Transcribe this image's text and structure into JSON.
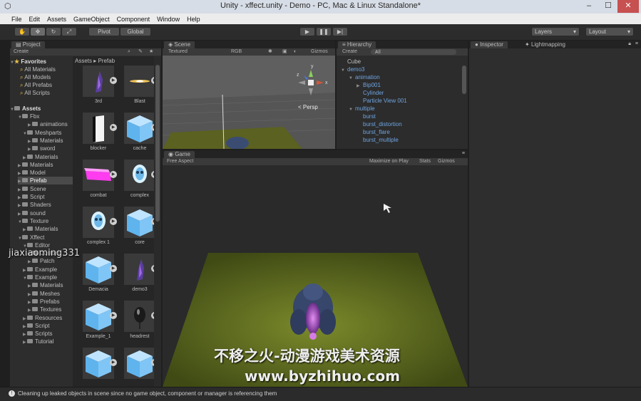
{
  "window": {
    "title": "Unity - xffect.unity - Demo - PC, Mac & Linux Standalone*",
    "minimize": "–",
    "maximize": "☐",
    "close": "✕"
  },
  "menu": [
    "File",
    "Edit",
    "Assets",
    "GameObject",
    "Component",
    "Window",
    "Help"
  ],
  "toolbar": {
    "pivot": "Pivot",
    "global": "Global",
    "layers": "Layers",
    "layout": "Layout"
  },
  "project": {
    "tab": "Project",
    "create": "Create",
    "breadcrumb": "Assets ▸ Prefab",
    "favorites_label": "Favorites",
    "favorites": [
      "All Materials",
      "All Models",
      "All Prefabs",
      "All Scripts"
    ],
    "assets_label": "Assets",
    "tree": [
      {
        "label": "Fbx",
        "indent": 1,
        "open": true
      },
      {
        "label": "animations",
        "indent": 3,
        "open": false
      },
      {
        "label": "Meshparts",
        "indent": 2,
        "open": true
      },
      {
        "label": "Materials",
        "indent": 3,
        "open": false
      },
      {
        "label": "sword",
        "indent": 3,
        "open": false
      },
      {
        "label": "Materials",
        "indent": 2,
        "open": false
      },
      {
        "label": "Materials",
        "indent": 1,
        "open": false
      },
      {
        "label": "Model",
        "indent": 1,
        "open": false
      },
      {
        "label": "Prefab",
        "indent": 1,
        "open": false,
        "selected": true
      },
      {
        "label": "Scene",
        "indent": 1,
        "open": false
      },
      {
        "label": "Script",
        "indent": 1,
        "open": false
      },
      {
        "label": "Shaders",
        "indent": 1,
        "open": false
      },
      {
        "label": "sound",
        "indent": 1,
        "open": false
      },
      {
        "label": "Texture",
        "indent": 1,
        "open": true
      },
      {
        "label": "Materials",
        "indent": 2,
        "open": false
      },
      {
        "label": "Xffect",
        "indent": 1,
        "open": true
      },
      {
        "label": "Editor",
        "indent": 2,
        "open": true
      },
      {
        "label": "Custom",
        "indent": 3,
        "open": false
      },
      {
        "label": "Patch",
        "indent": 3,
        "open": false
      },
      {
        "label": "Example",
        "indent": 2,
        "open": false
      },
      {
        "label": "Example",
        "indent": 2,
        "open": true
      },
      {
        "label": "Materials",
        "indent": 3,
        "open": false
      },
      {
        "label": "Meshes",
        "indent": 3,
        "open": false
      },
      {
        "label": "Prefabs",
        "indent": 3,
        "open": false
      },
      {
        "label": "Textures",
        "indent": 3,
        "open": false
      },
      {
        "label": "Resources",
        "indent": 2,
        "open": false
      },
      {
        "label": "Script",
        "indent": 2,
        "open": false
      },
      {
        "label": "Scripts",
        "indent": 2,
        "open": false
      },
      {
        "label": "Tutorial",
        "indent": 2,
        "open": false
      }
    ],
    "assets": [
      {
        "label": "3rd",
        "kind": "figure"
      },
      {
        "label": "Blast",
        "kind": "streak"
      },
      {
        "label": "blocker",
        "kind": "slab"
      },
      {
        "label": "cache",
        "kind": "cube"
      },
      {
        "label": "combat",
        "kind": "pink"
      },
      {
        "label": "complex",
        "kind": "skull"
      },
      {
        "label": "complex 1",
        "kind": "skull"
      },
      {
        "label": "core",
        "kind": "cube"
      },
      {
        "label": "Demacia",
        "kind": "cube"
      },
      {
        "label": "demo3",
        "kind": "figure"
      },
      {
        "label": "Example_1",
        "kind": "cube"
      },
      {
        "label": "headrest",
        "kind": "ball"
      },
      {
        "label": "",
        "kind": "cube"
      },
      {
        "label": "",
        "kind": "cube"
      }
    ]
  },
  "scene": {
    "tab": "Scene",
    "shading": "Textured",
    "render": "RGB",
    "gizmos": "Gizmos",
    "persp": "< Persp",
    "axis_y": "y",
    "axis_x": "x",
    "axis_z": "z"
  },
  "hierarchy": {
    "tab": "Hierarchy",
    "create": "Create",
    "search": "All",
    "items": [
      {
        "label": "Cube",
        "indent": 0,
        "style": "plain",
        "arrow": ""
      },
      {
        "label": "demo3",
        "indent": 0,
        "style": "prefab",
        "arrow": "▼"
      },
      {
        "label": "animation",
        "indent": 1,
        "style": "prefab",
        "arrow": "▼"
      },
      {
        "label": "Bip001",
        "indent": 2,
        "style": "prefab",
        "arrow": "▶"
      },
      {
        "label": "Cylinder",
        "indent": 2,
        "style": "prefab",
        "arrow": ""
      },
      {
        "label": "Particle View 001",
        "indent": 2,
        "style": "prefab",
        "arrow": ""
      },
      {
        "label": "multiple",
        "indent": 1,
        "style": "prefab",
        "arrow": "▼"
      },
      {
        "label": "burst",
        "indent": 2,
        "style": "prefab",
        "arrow": ""
      },
      {
        "label": "burst_distortion",
        "indent": 2,
        "style": "prefab",
        "arrow": ""
      },
      {
        "label": "burst_flare",
        "indent": 2,
        "style": "prefab",
        "arrow": ""
      },
      {
        "label": "burst_multiple",
        "indent": 2,
        "style": "prefab",
        "arrow": ""
      }
    ]
  },
  "inspector": {
    "tab": "Inspector",
    "tab2": "Lightmapping"
  },
  "game": {
    "tab": "Game",
    "aspect": "Free Aspect",
    "maximize": "Maximize on Play",
    "stats": "Stats",
    "gizmos": "Gizmos"
  },
  "status": {
    "message": "Cleaning up leaked objects in scene since no game object, component or manager is referencing them"
  },
  "watermarks": {
    "user": "jiaxiaoming331",
    "chinese": "不移之火-动漫游戏美术资源",
    "url": "www.byzhihuo.com"
  },
  "colors": {
    "prefab_blue": "#6fa4e0",
    "grass": "#5a6a1e",
    "selection": "#3e5f96"
  }
}
